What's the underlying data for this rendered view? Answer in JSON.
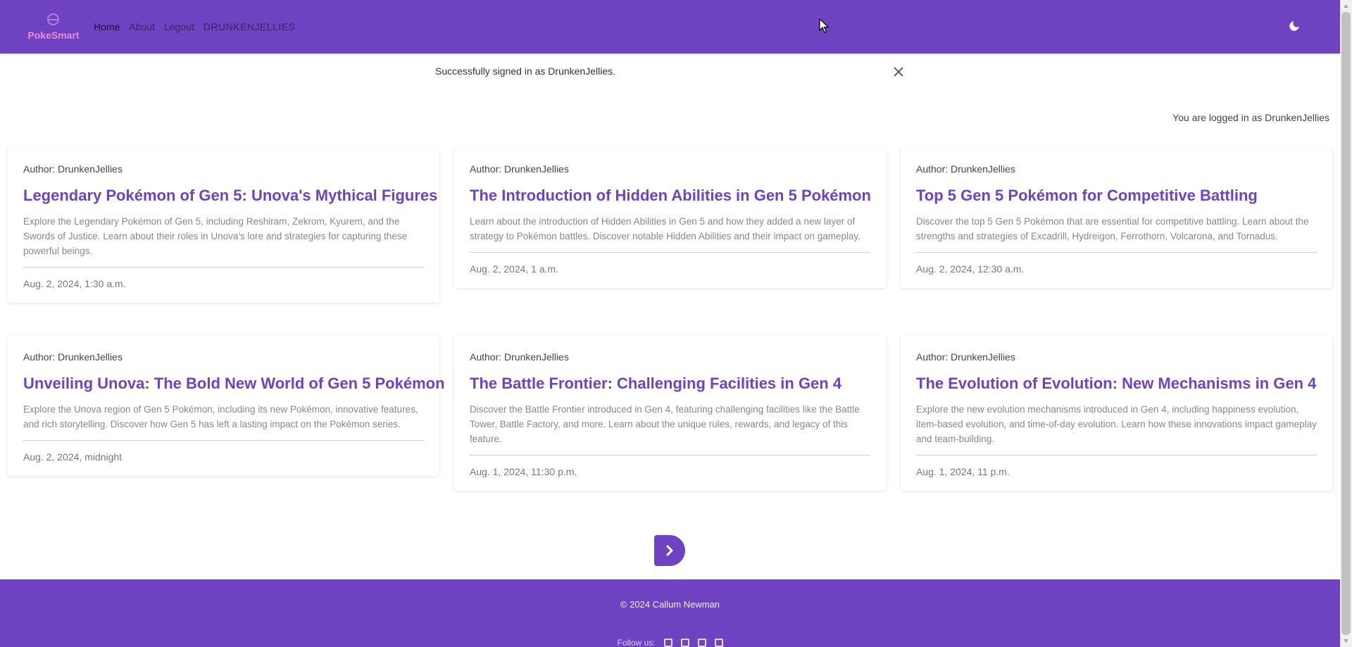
{
  "navbar": {
    "brand": "PokeSmart",
    "links": [
      {
        "label": "Home"
      },
      {
        "label": "About"
      },
      {
        "label": "Logout"
      },
      {
        "label": "DRUNKENJELLIES"
      }
    ],
    "theme_icon": "moon-icon"
  },
  "alert": {
    "message": "Successfully signed in as DrunkenJellies.",
    "close_icon": "close-icon"
  },
  "logged_in_text": "You are logged in as DrunkenJellies",
  "posts": [
    {
      "author": "Author: DrunkenJellies",
      "title": "Legendary Pokémon of Gen 5: Unova's Mythical Figures",
      "description": "Explore the Legendary Pokémon of Gen 5, including Reshiram, Zekrom, Kyurem, and the Swords of Justice. Learn about their roles in Unova's lore and strategies for capturing these powerful beings.",
      "date": "Aug. 2, 2024, 1:30 a.m."
    },
    {
      "author": "Author: DrunkenJellies",
      "title": "The Introduction of Hidden Abilities in Gen 5 Pokémon",
      "description": "Learn about the introduction of Hidden Abilities in Gen 5 and how they added a new layer of strategy to Pokémon battles. Discover notable Hidden Abilities and their impact on gameplay.",
      "date": "Aug. 2, 2024, 1 a.m."
    },
    {
      "author": "Author: DrunkenJellies",
      "title": "Top 5 Gen 5 Pokémon for Competitive Battling",
      "description": "Discover the top 5 Gen 5 Pokémon that are essential for competitive battling. Learn about the strengths and strategies of Excadrill, Hydreigon, Ferrothorn, Volcarona, and Tornadus.",
      "date": "Aug. 2, 2024, 12:30 a.m."
    },
    {
      "author": "Author: DrunkenJellies",
      "title": "Unveiling Unova: The Bold New World of Gen 5 Pokémon",
      "description": "Explore the Unova region of Gen 5 Pokémon, including its new Pokémon, innovative features, and rich storytelling. Discover how Gen 5 has left a lasting impact on the Pokémon series.",
      "date": "Aug. 2, 2024, midnight"
    },
    {
      "author": "Author: DrunkenJellies",
      "title": "The Battle Frontier: Challenging Facilities in Gen 4",
      "description": "Discover the Battle Frontier introduced in Gen 4, featuring challenging facilities like the Battle Tower, Battle Factory, and more. Learn about the unique rules, rewards, and legacy of this feature.",
      "date": "Aug. 1, 2024, 11:30 p.m."
    },
    {
      "author": "Author: DrunkenJellies",
      "title": "The Evolution of Evolution: New Mechanisms in Gen 4",
      "description": "Explore the new evolution mechanisms introduced in Gen 4, including happiness evolution, item-based evolution, and time-of-day evolution. Learn how these innovations impact gameplay and team-building.",
      "date": "Aug. 1, 2024, 11 p.m."
    }
  ],
  "pager": {
    "next_icon": "chevron-right-icon"
  },
  "footer": {
    "copyright": "© 2024 Callum Newman",
    "follow_label": "Follow us:",
    "social_icons": [
      "facebook-icon",
      "twitter-icon",
      "instagram-icon",
      "linkedin-icon"
    ]
  },
  "colors": {
    "primary": "#6f42c1",
    "brand_text": "#e98fd8"
  }
}
